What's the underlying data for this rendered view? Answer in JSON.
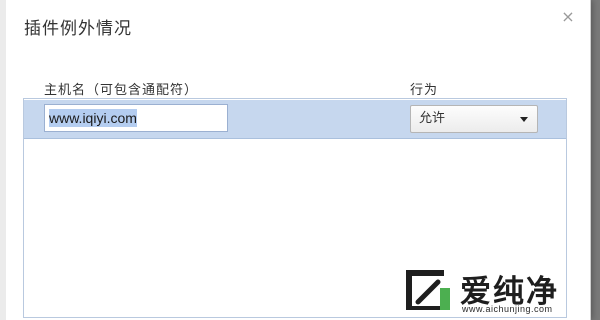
{
  "dialog": {
    "title": "插件例外情况",
    "close_symbol": "×"
  },
  "table": {
    "columns": [
      {
        "label": "主机名（可包含通配符）"
      },
      {
        "label": "行为"
      }
    ],
    "rows": [
      {
        "host": "www.iqiyi.com",
        "action": "允许"
      }
    ]
  },
  "watermark": {
    "brand": "爱纯净",
    "url": "www.aichunjing.com"
  },
  "colors": {
    "row_selected": "#c6d7ee",
    "table_border": "#b9c9df",
    "text": "#333333"
  }
}
